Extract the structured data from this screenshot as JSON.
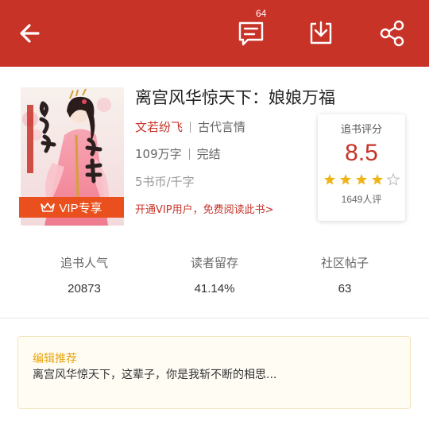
{
  "header": {
    "comment_count": "64",
    "icons": [
      "back-arrow-icon",
      "comment-icon",
      "download-icon",
      "share-icon"
    ],
    "background_color": "#c83328"
  },
  "book": {
    "title": "离宫风华惊天下：娘娘万福",
    "author": "文若纷飞",
    "category": "古代言情",
    "word_count": "109万字",
    "status": "完结",
    "price": "5书币/千字",
    "cover_calligraphy": "娘娘万福",
    "vip_badge": "VIP专享",
    "vip_link": "开通VIP用户，免费阅读此书>"
  },
  "rating": {
    "label": "追书评分",
    "score": "8.5",
    "stars_filled": 4,
    "stars_total": 5,
    "count": "1649人评"
  },
  "stats": [
    {
      "label": "追书人气",
      "value": "20873"
    },
    {
      "label": "读者留存",
      "value": "41.14%"
    },
    {
      "label": "社区帖子",
      "value": "63"
    }
  ],
  "editor": {
    "title": "编辑推荐",
    "text": "离宫风华惊天下，这辈子，你是我斩不断的相思..."
  },
  "colors": {
    "accent": "#c83328",
    "vip_orange": "#e9501e",
    "star_gold": "#f0b419",
    "editor_title": "#e9a50d"
  }
}
